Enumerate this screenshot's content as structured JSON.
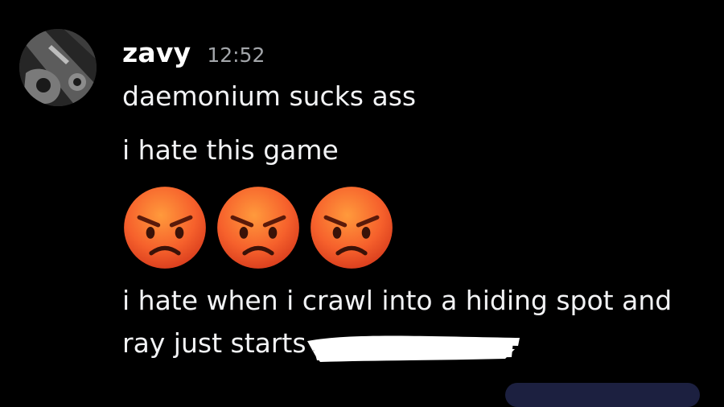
{
  "message": {
    "username": "zavy",
    "timestamp": "12:52",
    "lines": [
      "daemonium sucks ass",
      "i hate this game",
      "i hate when i crawl into a hiding spot and",
      "ray just starts"
    ],
    "emojis": [
      "angry-face-emoji",
      "angry-face-emoji",
      "angry-face-emoji"
    ]
  },
  "avatar": {
    "icon": "user-avatar"
  },
  "colors": {
    "background": "#000000",
    "text": "#f2f3f5",
    "timestamp": "#a3a6aa",
    "emoji_face": "#f6612c"
  }
}
